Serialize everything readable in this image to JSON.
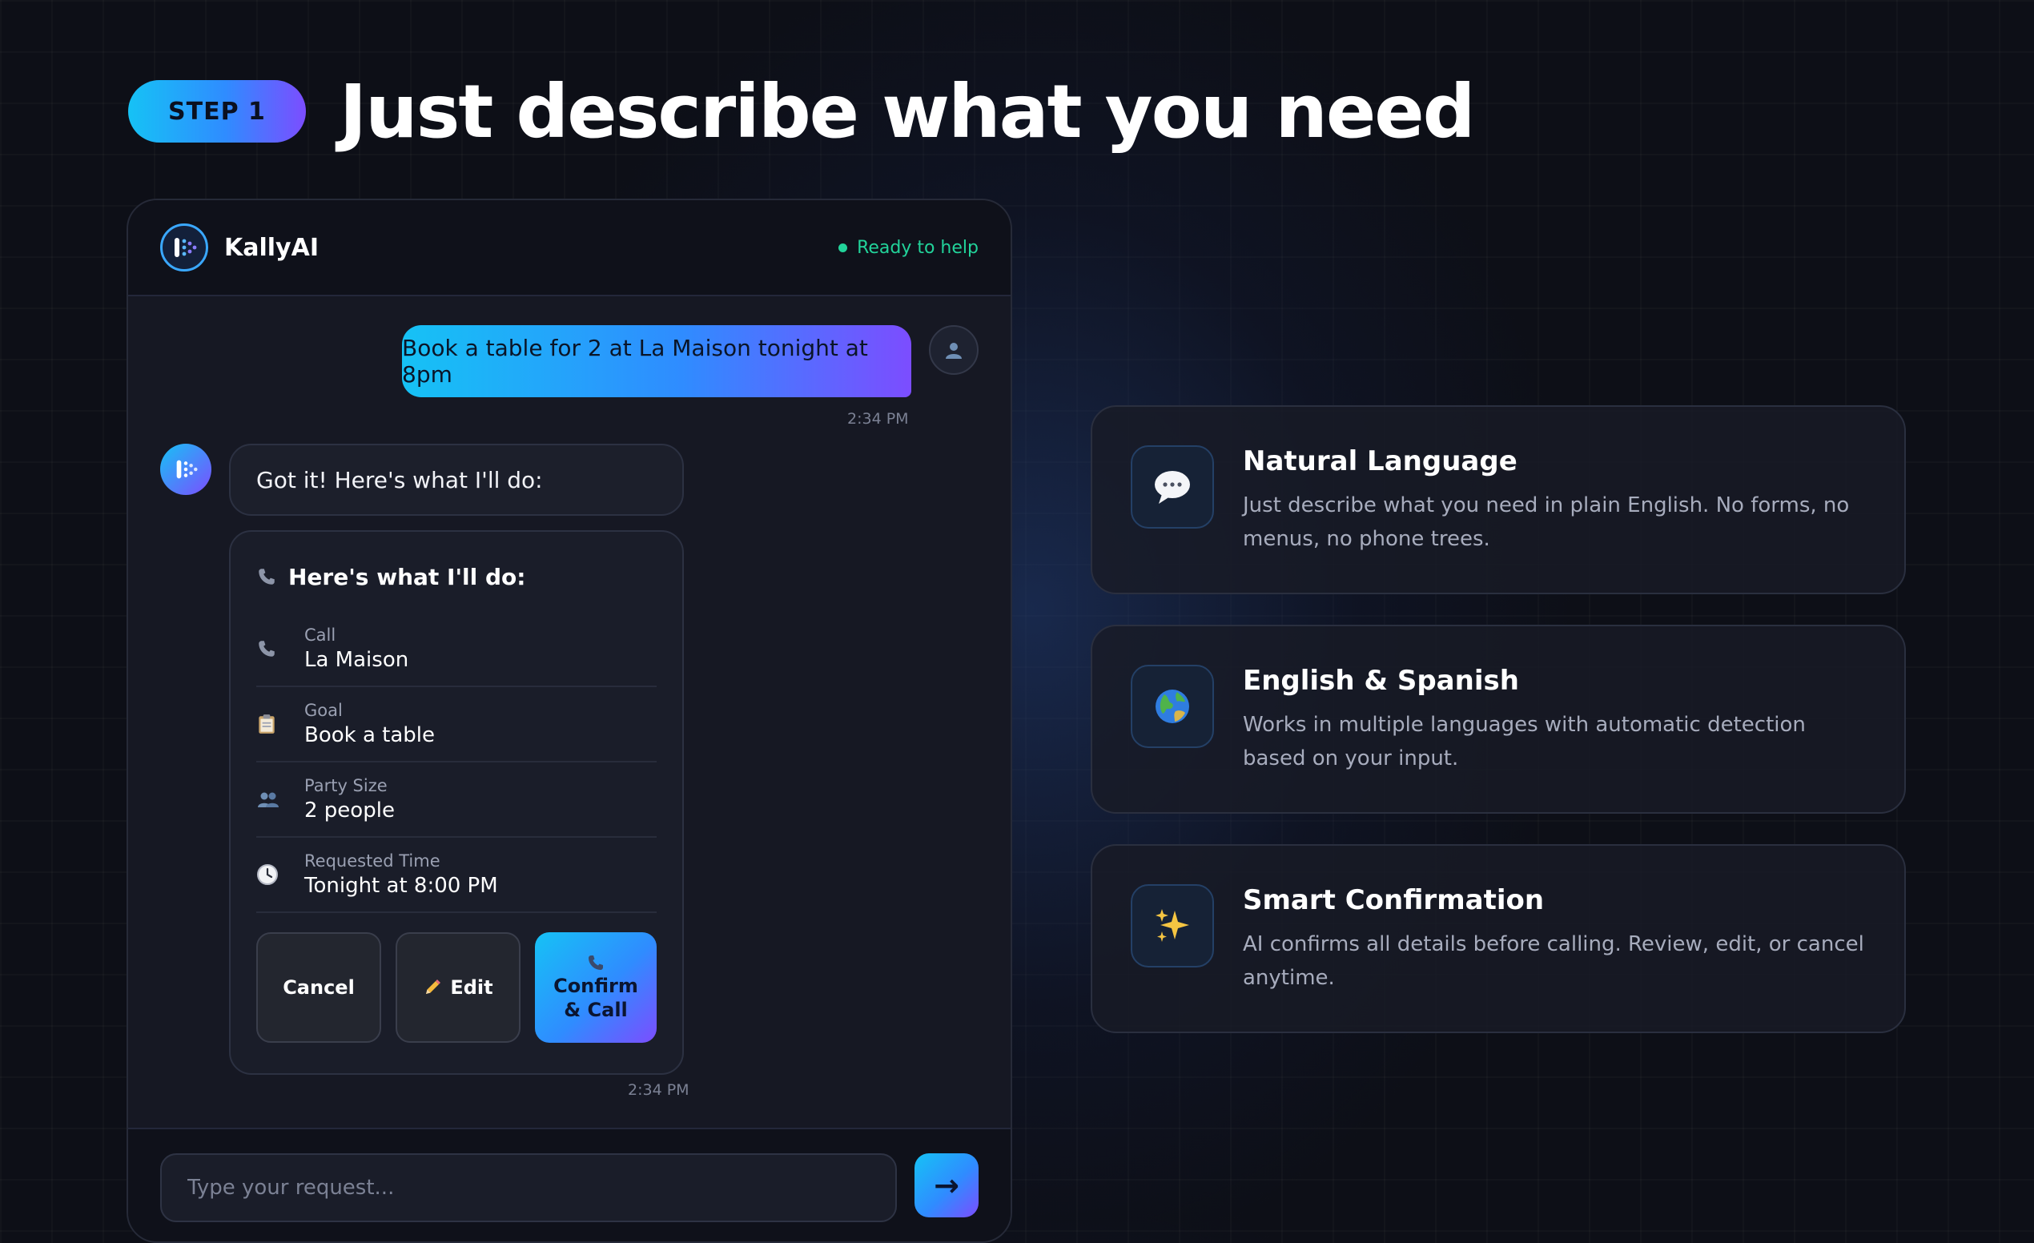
{
  "header": {
    "step_badge": "STEP 1",
    "headline": "Just describe what you need"
  },
  "chat": {
    "app_name": "KallyAI",
    "status": "Ready to help",
    "user_message": "Book a table for 2 at La Maison tonight at 8pm",
    "user_timestamp": "2:34 PM",
    "bot_message": "Got it! Here's what I'll do:",
    "plan": {
      "title": "Here's what I'll do:",
      "rows": [
        {
          "icon": "phone-icon",
          "label": "Call",
          "value": "La Maison"
        },
        {
          "icon": "clipboard-icon",
          "label": "Goal",
          "value": "Book a table"
        },
        {
          "icon": "people-icon",
          "label": "Party Size",
          "value": "2 people"
        },
        {
          "icon": "clock-icon",
          "label": "Requested Time",
          "value": "Tonight at 8:00 PM"
        }
      ],
      "cancel_label": "Cancel",
      "edit_label": "Edit",
      "confirm_label": "Confirm & Call"
    },
    "bot_timestamp": "2:34 PM",
    "input_placeholder": "Type your request...",
    "send_icon": "arrow-right-icon"
  },
  "features": [
    {
      "icon": "speech-bubble-icon",
      "title": "Natural Language",
      "description": "Just describe what you need in plain English. No forms, no menus, no phone trees."
    },
    {
      "icon": "globe-icon",
      "title": "English & Spanish",
      "description": "Works in multiple languages with automatic detection based on your input."
    },
    {
      "icon": "sparkles-icon",
      "title": "Smart Confirmation",
      "description": "AI confirms all details before calling. Review, edit, or cancel anytime."
    }
  ],
  "colors": {
    "background": "#0d0f17",
    "accent_start": "#16c2f5",
    "accent_end": "#7c4dff",
    "status_green": "#22d39a"
  }
}
